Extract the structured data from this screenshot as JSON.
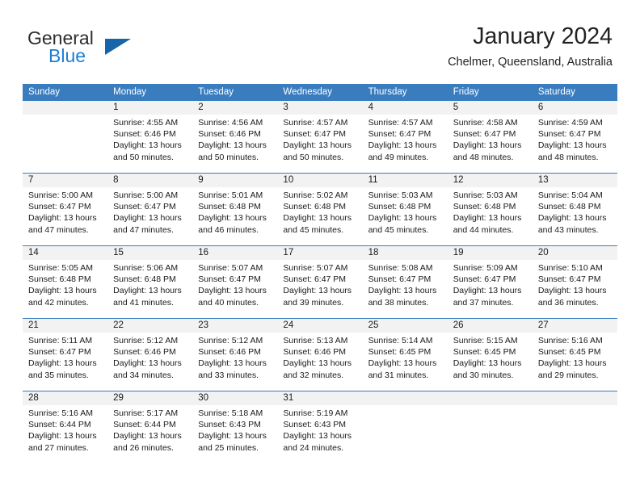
{
  "logo": {
    "word1": "General",
    "word2": "Blue",
    "triangle_color": "#1565a8",
    "blue_color": "#1c7fd4"
  },
  "header": {
    "title": "January 2024",
    "subtitle": "Chelmer, Queensland, Australia"
  },
  "theme": {
    "header_blue": "#3A7DBF",
    "daynum_gray": "#F2F2F2"
  },
  "weekdays": [
    "Sunday",
    "Monday",
    "Tuesday",
    "Wednesday",
    "Thursday",
    "Friday",
    "Saturday"
  ],
  "weeks": [
    [
      {
        "day": "",
        "sunrise": "",
        "sunset": "",
        "daylight1": "",
        "daylight2": ""
      },
      {
        "day": "1",
        "sunrise": "Sunrise: 4:55 AM",
        "sunset": "Sunset: 6:46 PM",
        "daylight1": "Daylight: 13 hours",
        "daylight2": "and 50 minutes."
      },
      {
        "day": "2",
        "sunrise": "Sunrise: 4:56 AM",
        "sunset": "Sunset: 6:46 PM",
        "daylight1": "Daylight: 13 hours",
        "daylight2": "and 50 minutes."
      },
      {
        "day": "3",
        "sunrise": "Sunrise: 4:57 AM",
        "sunset": "Sunset: 6:47 PM",
        "daylight1": "Daylight: 13 hours",
        "daylight2": "and 50 minutes."
      },
      {
        "day": "4",
        "sunrise": "Sunrise: 4:57 AM",
        "sunset": "Sunset: 6:47 PM",
        "daylight1": "Daylight: 13 hours",
        "daylight2": "and 49 minutes."
      },
      {
        "day": "5",
        "sunrise": "Sunrise: 4:58 AM",
        "sunset": "Sunset: 6:47 PM",
        "daylight1": "Daylight: 13 hours",
        "daylight2": "and 48 minutes."
      },
      {
        "day": "6",
        "sunrise": "Sunrise: 4:59 AM",
        "sunset": "Sunset: 6:47 PM",
        "daylight1": "Daylight: 13 hours",
        "daylight2": "and 48 minutes."
      }
    ],
    [
      {
        "day": "7",
        "sunrise": "Sunrise: 5:00 AM",
        "sunset": "Sunset: 6:47 PM",
        "daylight1": "Daylight: 13 hours",
        "daylight2": "and 47 minutes."
      },
      {
        "day": "8",
        "sunrise": "Sunrise: 5:00 AM",
        "sunset": "Sunset: 6:47 PM",
        "daylight1": "Daylight: 13 hours",
        "daylight2": "and 47 minutes."
      },
      {
        "day": "9",
        "sunrise": "Sunrise: 5:01 AM",
        "sunset": "Sunset: 6:48 PM",
        "daylight1": "Daylight: 13 hours",
        "daylight2": "and 46 minutes."
      },
      {
        "day": "10",
        "sunrise": "Sunrise: 5:02 AM",
        "sunset": "Sunset: 6:48 PM",
        "daylight1": "Daylight: 13 hours",
        "daylight2": "and 45 minutes."
      },
      {
        "day": "11",
        "sunrise": "Sunrise: 5:03 AM",
        "sunset": "Sunset: 6:48 PM",
        "daylight1": "Daylight: 13 hours",
        "daylight2": "and 45 minutes."
      },
      {
        "day": "12",
        "sunrise": "Sunrise: 5:03 AM",
        "sunset": "Sunset: 6:48 PM",
        "daylight1": "Daylight: 13 hours",
        "daylight2": "and 44 minutes."
      },
      {
        "day": "13",
        "sunrise": "Sunrise: 5:04 AM",
        "sunset": "Sunset: 6:48 PM",
        "daylight1": "Daylight: 13 hours",
        "daylight2": "and 43 minutes."
      }
    ],
    [
      {
        "day": "14",
        "sunrise": "Sunrise: 5:05 AM",
        "sunset": "Sunset: 6:48 PM",
        "daylight1": "Daylight: 13 hours",
        "daylight2": "and 42 minutes."
      },
      {
        "day": "15",
        "sunrise": "Sunrise: 5:06 AM",
        "sunset": "Sunset: 6:48 PM",
        "daylight1": "Daylight: 13 hours",
        "daylight2": "and 41 minutes."
      },
      {
        "day": "16",
        "sunrise": "Sunrise: 5:07 AM",
        "sunset": "Sunset: 6:47 PM",
        "daylight1": "Daylight: 13 hours",
        "daylight2": "and 40 minutes."
      },
      {
        "day": "17",
        "sunrise": "Sunrise: 5:07 AM",
        "sunset": "Sunset: 6:47 PM",
        "daylight1": "Daylight: 13 hours",
        "daylight2": "and 39 minutes."
      },
      {
        "day": "18",
        "sunrise": "Sunrise: 5:08 AM",
        "sunset": "Sunset: 6:47 PM",
        "daylight1": "Daylight: 13 hours",
        "daylight2": "and 38 minutes."
      },
      {
        "day": "19",
        "sunrise": "Sunrise: 5:09 AM",
        "sunset": "Sunset: 6:47 PM",
        "daylight1": "Daylight: 13 hours",
        "daylight2": "and 37 minutes."
      },
      {
        "day": "20",
        "sunrise": "Sunrise: 5:10 AM",
        "sunset": "Sunset: 6:47 PM",
        "daylight1": "Daylight: 13 hours",
        "daylight2": "and 36 minutes."
      }
    ],
    [
      {
        "day": "21",
        "sunrise": "Sunrise: 5:11 AM",
        "sunset": "Sunset: 6:47 PM",
        "daylight1": "Daylight: 13 hours",
        "daylight2": "and 35 minutes."
      },
      {
        "day": "22",
        "sunrise": "Sunrise: 5:12 AM",
        "sunset": "Sunset: 6:46 PM",
        "daylight1": "Daylight: 13 hours",
        "daylight2": "and 34 minutes."
      },
      {
        "day": "23",
        "sunrise": "Sunrise: 5:12 AM",
        "sunset": "Sunset: 6:46 PM",
        "daylight1": "Daylight: 13 hours",
        "daylight2": "and 33 minutes."
      },
      {
        "day": "24",
        "sunrise": "Sunrise: 5:13 AM",
        "sunset": "Sunset: 6:46 PM",
        "daylight1": "Daylight: 13 hours",
        "daylight2": "and 32 minutes."
      },
      {
        "day": "25",
        "sunrise": "Sunrise: 5:14 AM",
        "sunset": "Sunset: 6:45 PM",
        "daylight1": "Daylight: 13 hours",
        "daylight2": "and 31 minutes."
      },
      {
        "day": "26",
        "sunrise": "Sunrise: 5:15 AM",
        "sunset": "Sunset: 6:45 PM",
        "daylight1": "Daylight: 13 hours",
        "daylight2": "and 30 minutes."
      },
      {
        "day": "27",
        "sunrise": "Sunrise: 5:16 AM",
        "sunset": "Sunset: 6:45 PM",
        "daylight1": "Daylight: 13 hours",
        "daylight2": "and 29 minutes."
      }
    ],
    [
      {
        "day": "28",
        "sunrise": "Sunrise: 5:16 AM",
        "sunset": "Sunset: 6:44 PM",
        "daylight1": "Daylight: 13 hours",
        "daylight2": "and 27 minutes."
      },
      {
        "day": "29",
        "sunrise": "Sunrise: 5:17 AM",
        "sunset": "Sunset: 6:44 PM",
        "daylight1": "Daylight: 13 hours",
        "daylight2": "and 26 minutes."
      },
      {
        "day": "30",
        "sunrise": "Sunrise: 5:18 AM",
        "sunset": "Sunset: 6:43 PM",
        "daylight1": "Daylight: 13 hours",
        "daylight2": "and 25 minutes."
      },
      {
        "day": "31",
        "sunrise": "Sunrise: 5:19 AM",
        "sunset": "Sunset: 6:43 PM",
        "daylight1": "Daylight: 13 hours",
        "daylight2": "and 24 minutes."
      },
      {
        "day": "",
        "sunrise": "",
        "sunset": "",
        "daylight1": "",
        "daylight2": ""
      },
      {
        "day": "",
        "sunrise": "",
        "sunset": "",
        "daylight1": "",
        "daylight2": ""
      },
      {
        "day": "",
        "sunrise": "",
        "sunset": "",
        "daylight1": "",
        "daylight2": ""
      }
    ]
  ]
}
